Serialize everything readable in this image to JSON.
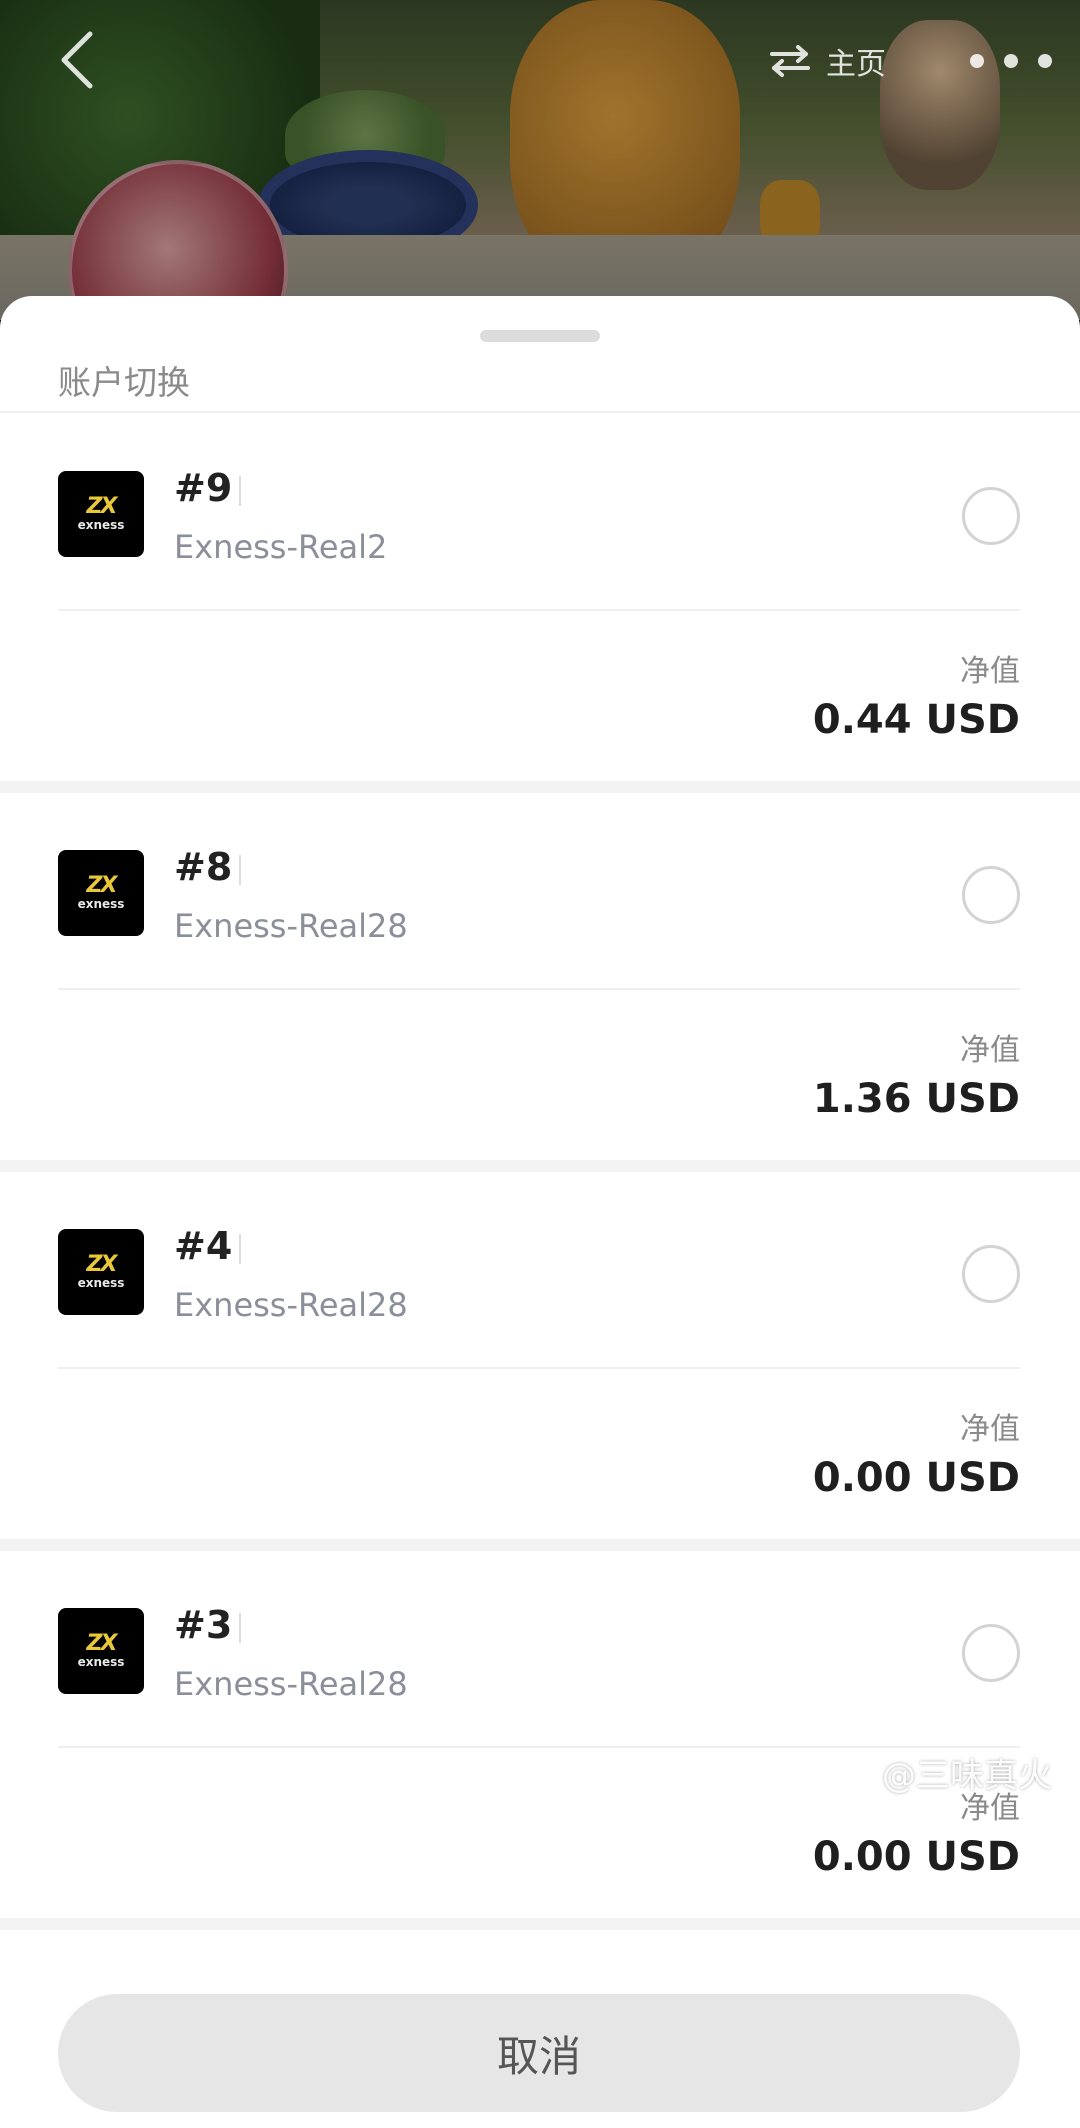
{
  "header": {
    "home_label": "主页"
  },
  "sheet": {
    "title": "账户切换"
  },
  "accounts": [
    {
      "number": "#9",
      "server": "Exness-Real2",
      "equity_label": "净值",
      "equity_value": "0.44 USD",
      "selected": false
    },
    {
      "number": "#8",
      "server": "Exness-Real28",
      "equity_label": "净值",
      "equity_value": "1.36 USD",
      "selected": false
    },
    {
      "number": "#4",
      "server": "Exness-Real28",
      "equity_label": "净值",
      "equity_value": "0.00 USD",
      "selected": false
    },
    {
      "number": "#3",
      "server": "Exness-Real28",
      "equity_label": "净值",
      "equity_value": "0.00 USD",
      "selected": false
    }
  ],
  "logo": {
    "mark": "ZX",
    "word": "exness"
  },
  "footer": {
    "cancel_label": "取消"
  },
  "watermark": {
    "text": "@三味真火"
  },
  "colors": {
    "sheet_bg": "#ffffff",
    "radio_border": "#d3d3d3",
    "cancel_bg": "#e6e6e6",
    "logo_bg": "#000000",
    "logo_accent": "#e8c838"
  }
}
